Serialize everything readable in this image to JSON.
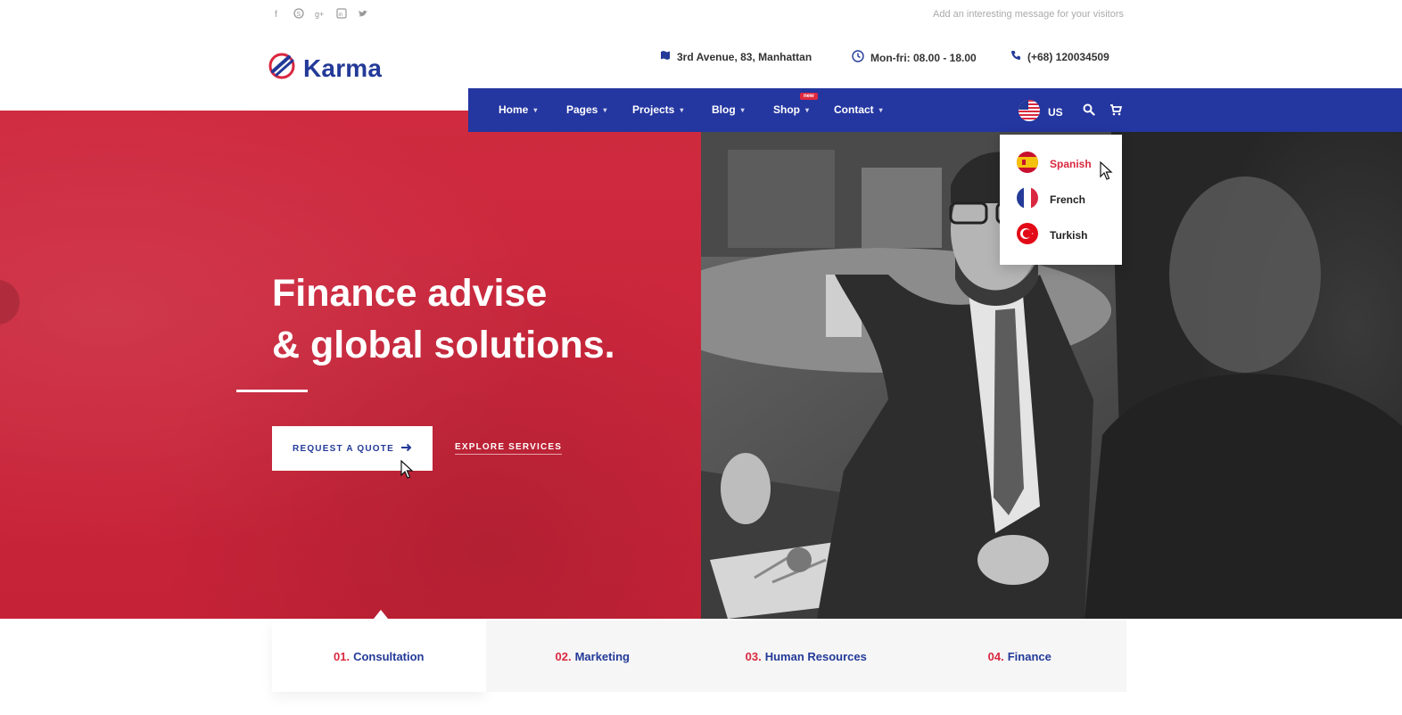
{
  "topbar": {
    "social_icons": [
      "facebook-icon",
      "skype-icon",
      "google-plus-icon",
      "linkedin-icon",
      "twitter-icon"
    ],
    "social_glyphs": [
      "f",
      "S",
      "g+",
      "in",
      "t"
    ],
    "message": "Add an interesting message for your visitors"
  },
  "header": {
    "logo_text": "Karma",
    "address": "3rd Avenue, 83, Manhattan",
    "hours": "Mon-fri: 08.00 - 18.00",
    "phone": "(+68) 120034509"
  },
  "nav": {
    "items": [
      {
        "label": "Home"
      },
      {
        "label": "Pages"
      },
      {
        "label": "Projects"
      },
      {
        "label": "Blog"
      },
      {
        "label": "Shop",
        "badge": "new"
      },
      {
        "label": "Contact"
      }
    ],
    "language": "US"
  },
  "language_dropdown": {
    "items": [
      {
        "label": "Spanish",
        "active": true
      },
      {
        "label": "French"
      },
      {
        "label": "Turkish"
      }
    ]
  },
  "hero": {
    "title_line1": "Finance advise",
    "title_line2": "& global solutions.",
    "primary_button": "REQUEST A QUOTE",
    "secondary_link": "EXPLORE SERVICES"
  },
  "services": {
    "tabs": [
      {
        "num": "01.",
        "label": "Consultation"
      },
      {
        "num": "02.",
        "label": "Marketing"
      },
      {
        "num": "03.",
        "label": "Human Resources"
      },
      {
        "num": "04.",
        "label": "Finance"
      }
    ]
  },
  "colors": {
    "brand_blue": "#2436a0",
    "brand_red": "#d9283f"
  }
}
